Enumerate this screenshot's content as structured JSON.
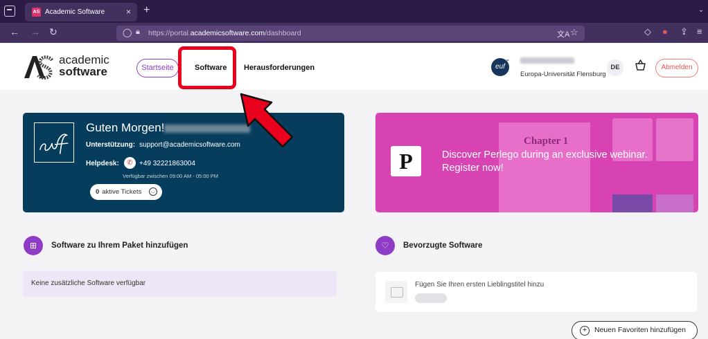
{
  "browser": {
    "tab_title": "Academic Software",
    "tab_favicon": "AS",
    "tab_close": "×",
    "new_tab": "+",
    "url_prefix": "https://portal.",
    "url_domain": "academicsoftware.com",
    "url_path": "/dashboard"
  },
  "header": {
    "logo_line1": "academic",
    "logo_line2": "software",
    "nav_start": "Startseite",
    "nav_software": "Software",
    "nav_challenges": "Herausforderungen",
    "university": "Europa-Universität Flensburg",
    "language": "DE",
    "logout": "Abmelden"
  },
  "welcome": {
    "greeting": "Guten Morgen!",
    "support_label": "Unterstützung:",
    "support_email": "support@academicsoftware.com",
    "helpdesk_label": "Helpdesk:",
    "phone": "+49 32221863004",
    "hours": "Verfügbar zwischen 09:00 AM - 05:00 PM",
    "ticket_count": "0",
    "ticket_label": "aktive Tickets"
  },
  "banner": {
    "logo_letter": "P",
    "chapter": "Chapter 1",
    "line1": "Discover Perlego during an exclusive webinar.",
    "line2": "Register now!"
  },
  "sections": {
    "add_software_title": "Software zu Ihrem Paket hinzufügen",
    "no_software": "Keine zusätzliche Software verfügbar",
    "favorites_title": "Bevorzugte Software",
    "favorites_empty": "Fügen Sie Ihren ersten Lieblingstitel hinzu",
    "add_favorites": "Neuen Favoriten hinzufügen"
  },
  "colors": {
    "accent": "#8e3cc6",
    "welcome_bg": "#073d5c",
    "banner_bg": "#d743b3",
    "highlight": "#e8001c"
  }
}
